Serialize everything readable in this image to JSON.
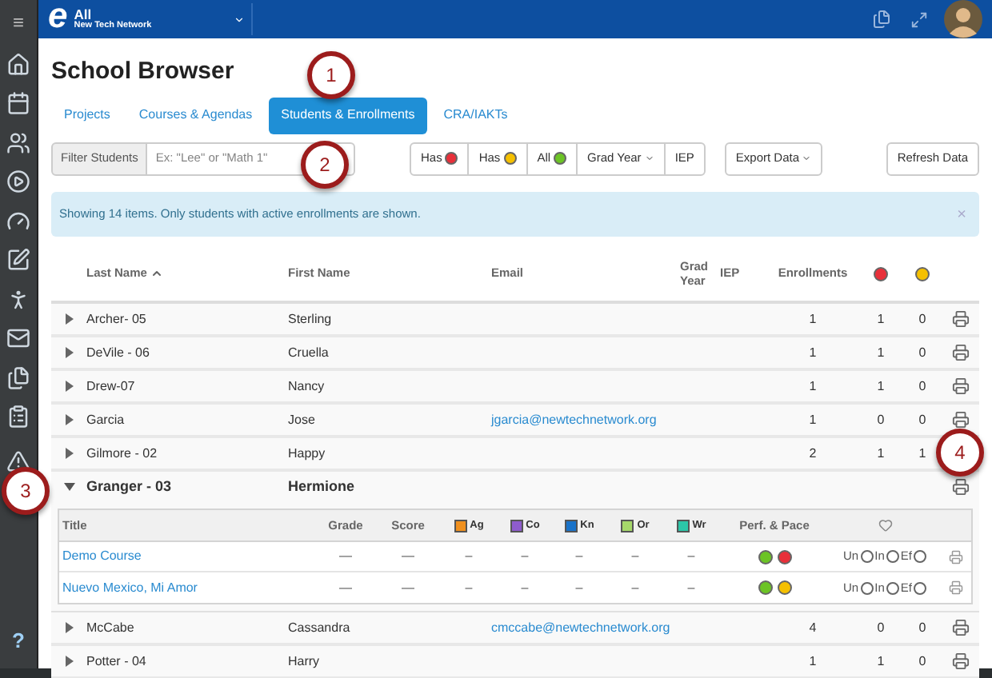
{
  "sidebar": {
    "menu": "≡",
    "help": "?"
  },
  "topbar": {
    "logo": "e",
    "scope": "All",
    "network": "New Tech Network"
  },
  "title": "School Browser",
  "tabs": [
    {
      "label": "Projects",
      "selected": false
    },
    {
      "label": "Courses & Agendas",
      "selected": false
    },
    {
      "label": "Students & Enrollments",
      "selected": true
    },
    {
      "label": "CRA/IAKTs",
      "selected": false
    }
  ],
  "filter": {
    "label": "Filter Students",
    "placeholder": "Ex: \"Lee\" or \"Math 1\""
  },
  "filter_buttons": [
    {
      "kind": "dot",
      "label": "Has",
      "color": "#e8303a"
    },
    {
      "kind": "dot",
      "label": "Has",
      "color": "#f5c000"
    },
    {
      "kind": "dot",
      "label": "All",
      "color": "#6cc425"
    },
    {
      "kind": "dropdown",
      "label": "Grad Year"
    },
    {
      "kind": "plain",
      "label": "IEP"
    }
  ],
  "export_button": "Export Data",
  "refresh_button": "Refresh Data",
  "alert": {
    "text": "Showing 14 items. Only students with active enrollments are shown.",
    "close": "×"
  },
  "table": {
    "columns": [
      {
        "kind": "text",
        "label": "Last Name",
        "sorted": true
      },
      {
        "kind": "text",
        "label": "First Name",
        "sorted": false
      },
      {
        "kind": "text",
        "label": "Email",
        "sorted": false
      },
      {
        "kind": "text",
        "label": "Grad Year",
        "sorted": false
      },
      {
        "kind": "text",
        "label": "IEP",
        "sorted": false
      },
      {
        "kind": "text",
        "label": "Enrollments",
        "sorted": false
      },
      {
        "kind": "dot",
        "color": "#e8303a"
      },
      {
        "kind": "dot",
        "color": "#f5c000"
      }
    ],
    "rows": [
      {
        "last": "Archer- 05",
        "first": "Sterling",
        "enrollments": "1",
        "red": "1",
        "yellow": "0",
        "expanded": false
      },
      {
        "last": "DeVile - 06",
        "first": "Cruella",
        "enrollments": "1",
        "red": "1",
        "yellow": "0",
        "expanded": false
      },
      {
        "last": "Drew-07",
        "first": "Nancy",
        "enrollments": "1",
        "red": "1",
        "yellow": "0",
        "expanded": false
      },
      {
        "last": "Garcia",
        "first": "Jose",
        "email": "jgarcia@newtechnetwork.org",
        "enrollments": "1",
        "red": "0",
        "yellow": "0",
        "expanded": false
      },
      {
        "last": "Gilmore - 02",
        "first": "Happy",
        "enrollments": "2",
        "red": "1",
        "yellow": "1",
        "expanded": false,
        "no_print": true
      },
      {
        "last": "Granger - 03",
        "first": "Hermione",
        "expanded": true,
        "detail": {
          "columns": [
            {
              "kind": "text",
              "label": "Title"
            },
            {
              "kind": "text",
              "label": "Grade"
            },
            {
              "kind": "text",
              "label": "Score"
            },
            {
              "kind": "swatch",
              "label": "Ag",
              "color": "#f0901e"
            },
            {
              "kind": "swatch",
              "label": "Co",
              "color": "#8e5ccc"
            },
            {
              "kind": "swatch",
              "label": "Kn",
              "color": "#1a73c9"
            },
            {
              "kind": "swatch",
              "label": "Or",
              "color": "#a6d86a"
            },
            {
              "kind": "swatch",
              "label": "Wr",
              "color": "#2cc6a8"
            },
            {
              "kind": "text",
              "label": "Perf. & Pace"
            },
            {
              "kind": "heart"
            }
          ],
          "courses": [
            {
              "title": "Demo Course",
              "grade": "—",
              "score": "—",
              "outcomes": [
                "–",
                "–",
                "–",
                "–",
                "–"
              ],
              "status": [
                {
                  "color": "#6cc425"
                },
                {
                  "color": "#e8303a"
                }
              ],
              "engagement": [
                {
                  "label": "Un",
                  "selected": false
                },
                {
                  "label": "In",
                  "selected": false
                },
                {
                  "label": "Ef",
                  "selected": false
                }
              ]
            },
            {
              "title": "Nuevo Mexico, Mi Amor",
              "grade": "—",
              "score": "—",
              "outcomes": [
                "–",
                "–",
                "–",
                "–",
                "–"
              ],
              "status": [
                {
                  "color": "#6cc425"
                },
                {
                  "color": "#f5c000"
                }
              ],
              "engagement": [
                {
                  "label": "Un",
                  "selected": false
                },
                {
                  "label": "In",
                  "selected": false
                },
                {
                  "label": "Ef",
                  "selected": false
                }
              ]
            }
          ]
        }
      },
      {
        "last": "McCabe",
        "first": "Cassandra",
        "email": "cmccabe@newtechnetwork.org",
        "enrollments": "4",
        "red": "0",
        "yellow": "0",
        "expanded": false
      },
      {
        "last": "Potter - 04",
        "first": "Harry",
        "enrollments": "1",
        "red": "1",
        "yellow": "0",
        "expanded": false
      }
    ]
  },
  "callouts": [
    "1",
    "2",
    "3",
    "4"
  ]
}
